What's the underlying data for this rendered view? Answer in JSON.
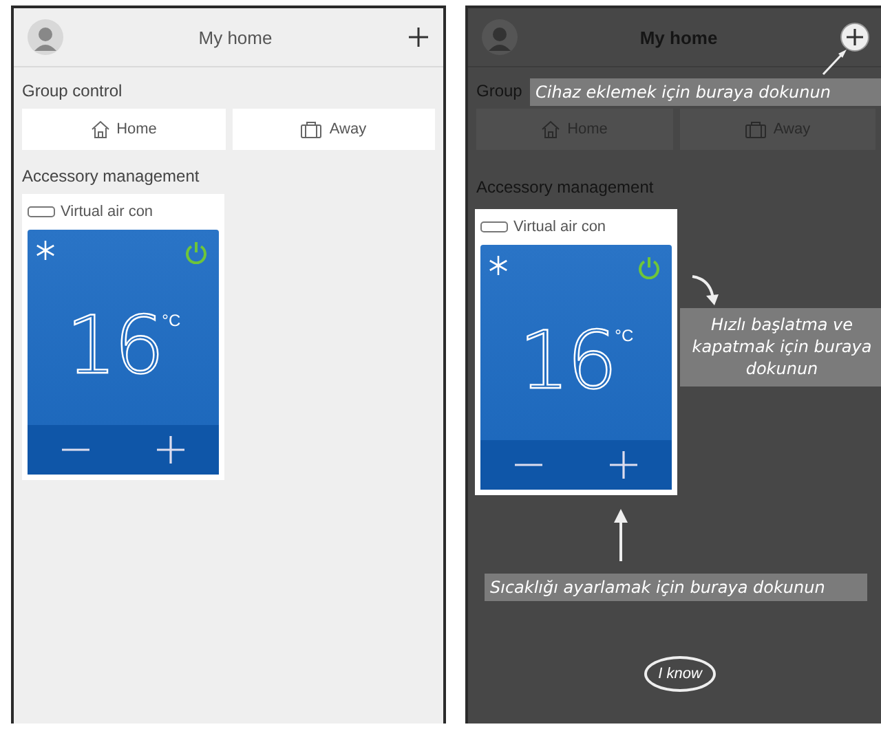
{
  "screens": [
    {
      "kind": "app",
      "header": {
        "title": "My home"
      },
      "group_heading": "Group control",
      "modes": [
        {
          "label": "Home",
          "kind": "house"
        },
        {
          "label": "Away",
          "kind": "suitcase"
        }
      ],
      "section_heading": "Accessory management",
      "device": {
        "name": "Virtual air con",
        "temperature": "16",
        "unit": "°C"
      }
    },
    {
      "kind": "guide",
      "header": {
        "title": "My home"
      },
      "group_heading": "Group",
      "modes": [
        {
          "label": "Home",
          "kind": "house"
        },
        {
          "label": "Away",
          "kind": "suitcase"
        }
      ],
      "section_heading": "Accessory management",
      "device": {
        "name": "Virtual air con",
        "temperature": "16",
        "unit": "°C"
      },
      "callouts": [
        {
          "kind": "add",
          "text": "Cihaz eklemek için buraya dokunun"
        },
        {
          "kind": "power",
          "text": "Hızlı başlatma ve kapatmak için buraya dokunun"
        },
        {
          "kind": "temperature",
          "text": "Sıcaklığı ayarlamak için buraya dokunun"
        }
      ],
      "dismiss": "I know"
    }
  ]
}
